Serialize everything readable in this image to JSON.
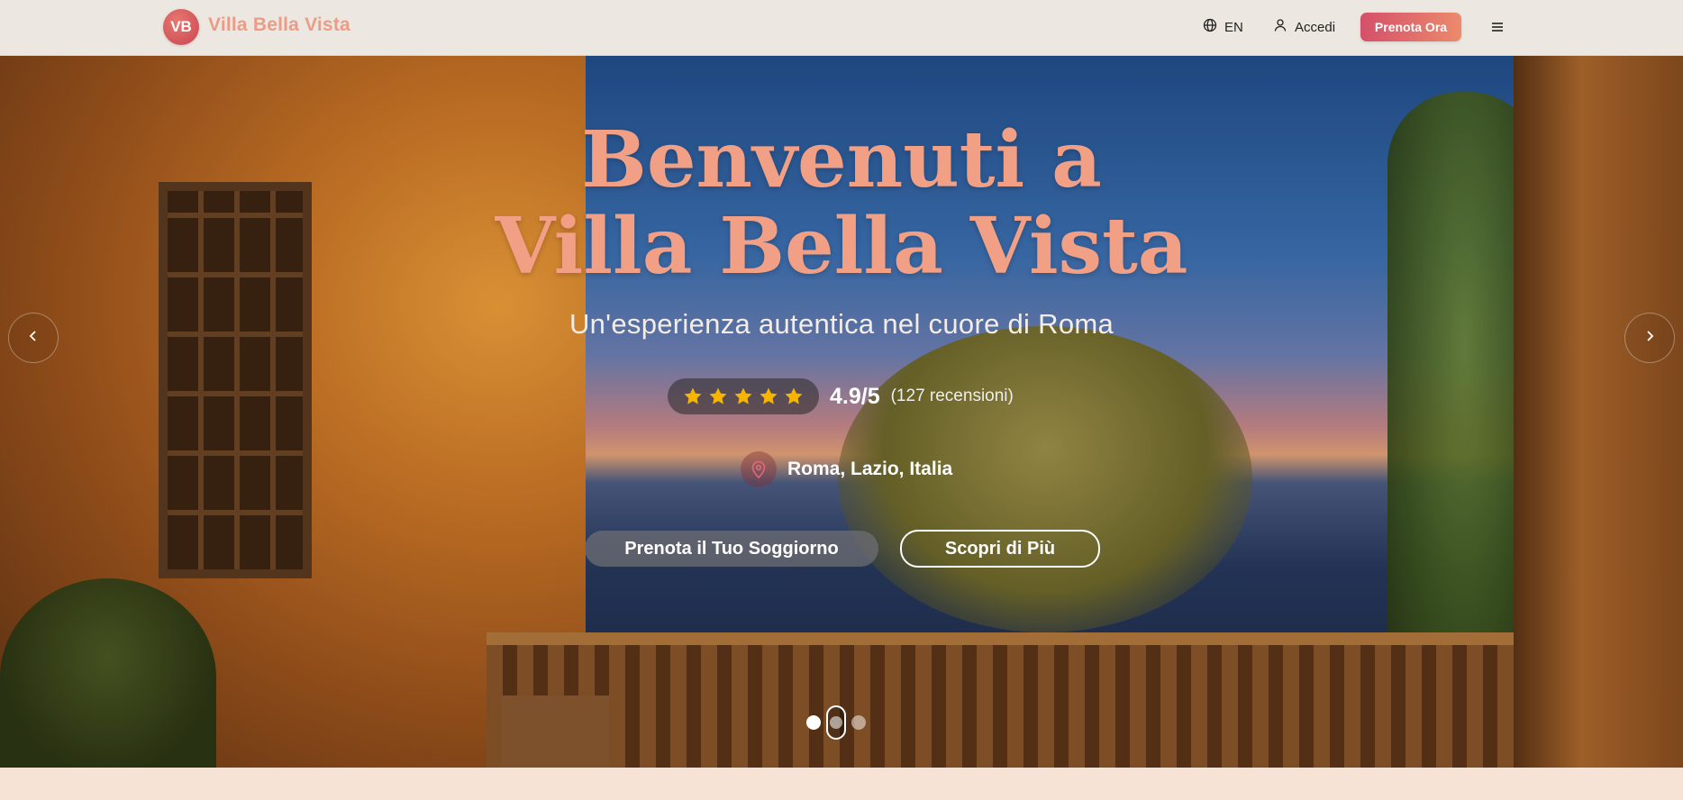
{
  "header": {
    "logo_initials": "VB",
    "brand_name": "Villa Bella Vista",
    "language": "EN",
    "login_label": "Accedi",
    "book_label": "Prenota Ora"
  },
  "hero": {
    "title_line1": "Benvenuti a",
    "title_line2": "Villa Bella Vista",
    "subtitle": "Un'esperienza autentica nel cuore di Roma",
    "rating": {
      "stars": 5,
      "score": "4.9/5",
      "count": "(127 recensioni)"
    },
    "location": "Roma, Lazio, Italia",
    "cta_primary": "Prenota il Tuo Soggiorno",
    "cta_secondary": "Scopri di Più",
    "slides_total": 3,
    "slide_active": 1
  },
  "colors": {
    "accent": "#d4506a",
    "accent_light": "#ec8a6c",
    "title": "#f2a085",
    "star": "#f7b500"
  },
  "icons": {
    "language": "globe-icon",
    "login": "user-icon",
    "menu": "hamburger-menu-icon",
    "location": "map-pin-icon",
    "prev": "chevron-left-icon",
    "next": "chevron-right-icon",
    "rating": "star-icon"
  }
}
